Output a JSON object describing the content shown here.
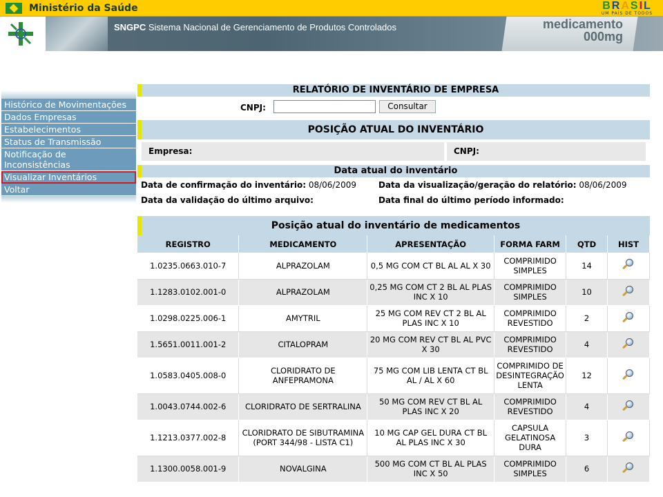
{
  "gov": {
    "title": "Ministério da Saúde",
    "brasil": "BRASIL",
    "brasil_sub": "UM PAÍS DE TODOS"
  },
  "banner": {
    "app_short": "SNGPC",
    "app_full": "Sistema Nacional de Gerenciamento de Produtos Controlados",
    "med_line1": "medicamento",
    "med_line2": "000mg"
  },
  "menu": {
    "items": [
      {
        "label": "Histórico de Movimentações"
      },
      {
        "label": "Dados Empresas"
      },
      {
        "label": "Estabelecimentos"
      },
      {
        "label": "Status de Transmissão"
      },
      {
        "label": "Notificação de Inconsistências"
      },
      {
        "label": "Visualizar Inventários"
      },
      {
        "label": "Voltar"
      }
    ]
  },
  "report": {
    "title": "RELATÓRIO DE INVENTÁRIO DE EMPRESA",
    "cnpj_label": "CNPJ:",
    "cnpj_value": "",
    "consult_button": "Consultar",
    "position_title": "POSIÇÃO ATUAL DO INVENTÁRIO",
    "empresa_label": "Empresa:",
    "cnpj2_label": "CNPJ:",
    "date_title": "Data atual do inventário",
    "confirm_label": "Data de confirmação do inventário:",
    "confirm_value": "08/06/2009",
    "view_label": "Data da visualização/geração do relatório:",
    "view_value": "08/06/2009",
    "validation_label": "Data da validação do último arquivo:",
    "final_label": "Data final do último período informado:",
    "meds_title": "Posição atual do inventário de medicamentos"
  },
  "table": {
    "headers": [
      "REGISTRO",
      "MEDICAMENTO",
      "APRESENTAÇÃO",
      "FORMA FARM",
      "QTD",
      "HIST"
    ],
    "rows": [
      {
        "registro": "1.0235.0663.010-7",
        "medicamento": "ALPRAZOLAM",
        "apresentacao": "0,5 MG COM CT BL AL AL X 30",
        "forma": "COMPRIMIDO SIMPLES",
        "qtd": "14"
      },
      {
        "registro": "1.1283.0102.001-0",
        "medicamento": "ALPRAZOLAM",
        "apresentacao": "0,25 MG COM CT 2 BL AL PLAS INC X 10",
        "forma": "COMPRIMIDO SIMPLES",
        "qtd": "10"
      },
      {
        "registro": "1.0298.0225.006-1",
        "medicamento": "AMYTRIL",
        "apresentacao": "25 MG COM REV CT 2 BL AL PLAS INC X 10",
        "forma": "COMPRIMIDO REVESTIDO",
        "qtd": "2"
      },
      {
        "registro": "1.5651.0011.001-2",
        "medicamento": "CITALOPRAM",
        "apresentacao": "20 MG COM REV CT BL AL PVC X 30",
        "forma": "COMPRIMIDO REVESTIDO",
        "qtd": "4"
      },
      {
        "registro": "1.0583.0405.008-0",
        "medicamento": "CLORIDRATO DE ANFEPRAMONA",
        "apresentacao": "75 MG COM LIB LENTA CT BL AL / AL X 60",
        "forma": "COMPRIMIDO DE DESINTEGRAÇÃO LENTA",
        "qtd": "12"
      },
      {
        "registro": "1.0043.0744.002-6",
        "medicamento": "CLORIDRATO DE SERTRALINA",
        "apresentacao": "50 MG COM REV CT BL AL PLAS INC X 20",
        "forma": "COMPRIMIDO REVESTIDO",
        "qtd": "4"
      },
      {
        "registro": "1.1213.0377.002-8",
        "medicamento": "CLORIDRATO DE SIBUTRAMINA (PORT 344/98 - LISTA C1)",
        "apresentacao": "10 MG CAP GEL DURA CT BL AL PLAS INC X 30",
        "forma": "CAPSULA GELATINOSA DURA",
        "qtd": "3"
      },
      {
        "registro": "1.1300.0058.001-9",
        "medicamento": "NOVALGINA",
        "apresentacao": "500 MG COM CT BL AL PLAS INC X 50",
        "forma": "COMPRIMIDO SIMPLES",
        "qtd": "6"
      }
    ]
  },
  "colors": {
    "menu_bg": "#6c9bbb",
    "header_bg": "#c5d8e6",
    "accent_yellow": "#e6e600",
    "gov_yellow": "#ffcc00",
    "active_outline": "#d8141c"
  }
}
